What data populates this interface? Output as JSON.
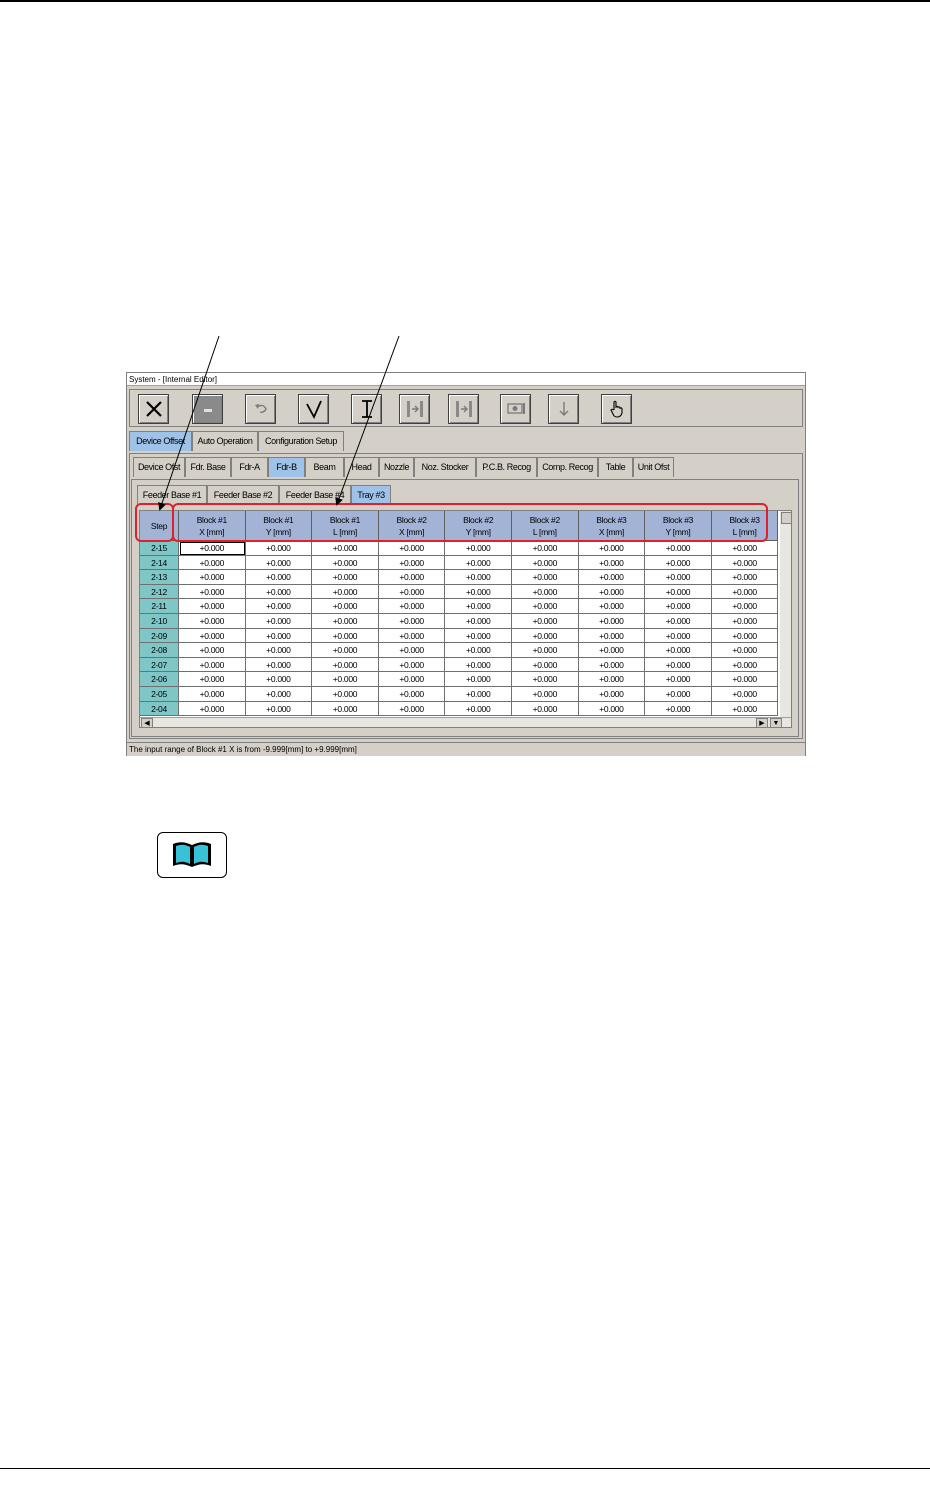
{
  "window": {
    "title": "System - [Internal Editor]",
    "status": "The input range of Block #1 X is from  -9.999[mm]  to  +9.999[mm]"
  },
  "toolbar": {
    "buttons": [
      "close-icon",
      "minimize-icon",
      "undo-icon",
      "check-icon",
      "text-cursor-icon",
      "step-forward-icon",
      "step-end-icon",
      "device-icon",
      "download-icon",
      "hand-pointer-icon"
    ]
  },
  "main_tabs": [
    {
      "label": "Device Offset",
      "active": true
    },
    {
      "label": "Auto Operation",
      "active": false
    },
    {
      "label": "Configuration Setup",
      "active": false
    }
  ],
  "sub_tabs": [
    {
      "label": "Device Ofst",
      "active": false
    },
    {
      "label": "Fdr. Base",
      "active": false
    },
    {
      "label": "Fdr-A",
      "active": false
    },
    {
      "label": "Fdr-B",
      "active": true
    },
    {
      "label": "Beam",
      "active": false
    },
    {
      "label": "Head",
      "active": false
    },
    {
      "label": "Nozzle",
      "active": false
    },
    {
      "label": "Noz. Stocker",
      "active": false
    },
    {
      "label": "P.C.B. Recog",
      "active": false
    },
    {
      "label": "Comp. Recog",
      "active": false
    },
    {
      "label": "Table",
      "active": false
    },
    {
      "label": "Unit Ofst",
      "active": false
    }
  ],
  "base_tabs": [
    {
      "label": "Feeder Base #1",
      "active": false
    },
    {
      "label": "Feeder Base #2",
      "active": false
    },
    {
      "label": "Feeder Base #4",
      "active": false
    },
    {
      "label": "Tray #3",
      "active": true
    }
  ],
  "table": {
    "step_header": "Step",
    "columns": [
      {
        "line1": "Block #1",
        "line2": "X [mm]"
      },
      {
        "line1": "Block #1",
        "line2": "Y [mm]"
      },
      {
        "line1": "Block #1",
        "line2": "L [mm]"
      },
      {
        "line1": "Block #2",
        "line2": "X [mm]"
      },
      {
        "line1": "Block #2",
        "line2": "Y [mm]"
      },
      {
        "line1": "Block #2",
        "line2": "L [mm]"
      },
      {
        "line1": "Block #3",
        "line2": "X [mm]"
      },
      {
        "line1": "Block #3",
        "line2": "Y [mm]"
      },
      {
        "line1": "Block #3",
        "line2": "L [mm]"
      }
    ],
    "rows": [
      {
        "step": "2-15",
        "values": [
          "+0.000",
          "+0.000",
          "+0.000",
          "+0.000",
          "+0.000",
          "+0.000",
          "+0.000",
          "+0.000",
          "+0.000"
        ]
      },
      {
        "step": "2-14",
        "values": [
          "+0.000",
          "+0.000",
          "+0.000",
          "+0.000",
          "+0.000",
          "+0.000",
          "+0.000",
          "+0.000",
          "+0.000"
        ]
      },
      {
        "step": "2-13",
        "values": [
          "+0.000",
          "+0.000",
          "+0.000",
          "+0.000",
          "+0.000",
          "+0.000",
          "+0.000",
          "+0.000",
          "+0.000"
        ]
      },
      {
        "step": "2-12",
        "values": [
          "+0.000",
          "+0.000",
          "+0.000",
          "+0.000",
          "+0.000",
          "+0.000",
          "+0.000",
          "+0.000",
          "+0.000"
        ]
      },
      {
        "step": "2-11",
        "values": [
          "+0.000",
          "+0.000",
          "+0.000",
          "+0.000",
          "+0.000",
          "+0.000",
          "+0.000",
          "+0.000",
          "+0.000"
        ]
      },
      {
        "step": "2-10",
        "values": [
          "+0.000",
          "+0.000",
          "+0.000",
          "+0.000",
          "+0.000",
          "+0.000",
          "+0.000",
          "+0.000",
          "+0.000"
        ]
      },
      {
        "step": "2-09",
        "values": [
          "+0.000",
          "+0.000",
          "+0.000",
          "+0.000",
          "+0.000",
          "+0.000",
          "+0.000",
          "+0.000",
          "+0.000"
        ]
      },
      {
        "step": "2-08",
        "values": [
          "+0.000",
          "+0.000",
          "+0.000",
          "+0.000",
          "+0.000",
          "+0.000",
          "+0.000",
          "+0.000",
          "+0.000"
        ]
      },
      {
        "step": "2-07",
        "values": [
          "+0.000",
          "+0.000",
          "+0.000",
          "+0.000",
          "+0.000",
          "+0.000",
          "+0.000",
          "+0.000",
          "+0.000"
        ]
      },
      {
        "step": "2-06",
        "values": [
          "+0.000",
          "+0.000",
          "+0.000",
          "+0.000",
          "+0.000",
          "+0.000",
          "+0.000",
          "+0.000",
          "+0.000"
        ]
      },
      {
        "step": "2-05",
        "values": [
          "+0.000",
          "+0.000",
          "+0.000",
          "+0.000",
          "+0.000",
          "+0.000",
          "+0.000",
          "+0.000",
          "+0.000"
        ]
      },
      {
        "step": "2-04",
        "values": [
          "+0.000",
          "+0.000",
          "+0.000",
          "+0.000",
          "+0.000",
          "+0.000",
          "+0.000",
          "+0.000",
          "+0.000"
        ]
      }
    ]
  },
  "colors": {
    "header_bg": "#a3b3d6",
    "step_bg": "#7fc6c6",
    "active_tab": "#9fc3e8",
    "annotation": "#e0202c"
  }
}
